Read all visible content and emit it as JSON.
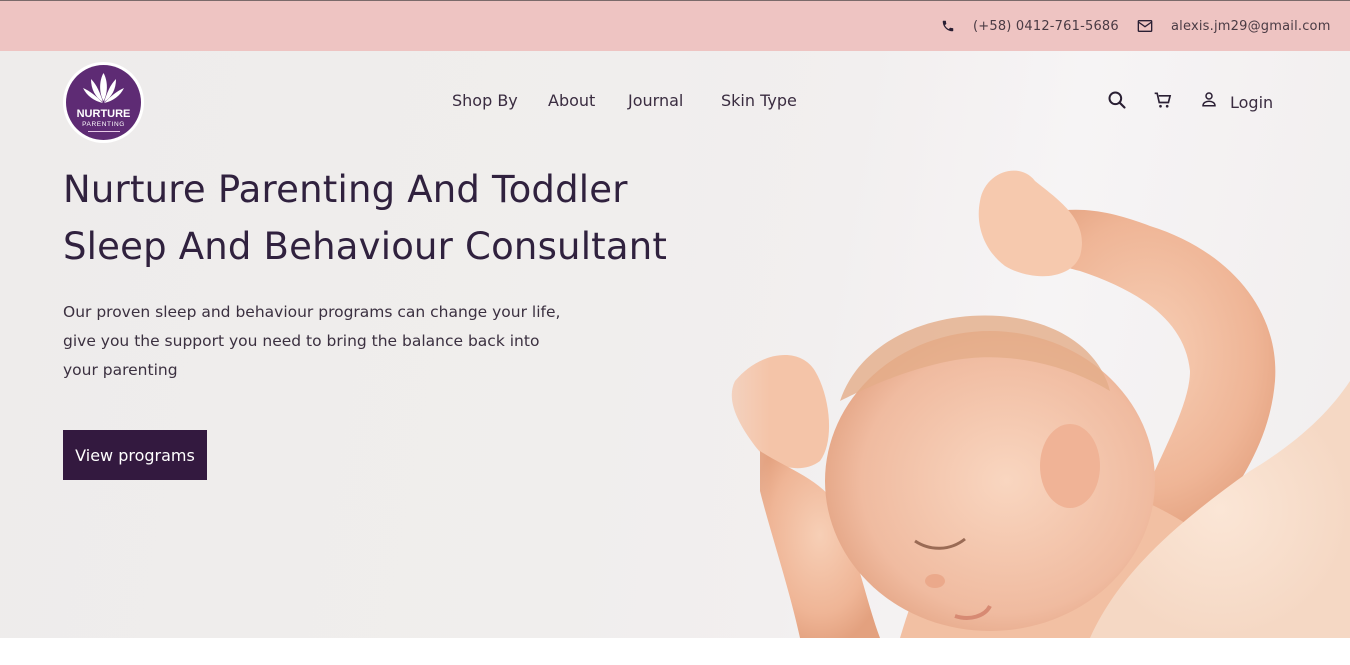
{
  "topbar": {
    "phone": "(+58) 0412-761-5686",
    "email": "alexis.jm29@gmail.com"
  },
  "logo": {
    "name": "NURTURE",
    "tagline": "PARENTING"
  },
  "nav": {
    "items": [
      "Shop By",
      "About",
      "Journal",
      "Skin Type"
    ]
  },
  "header_actions": {
    "search_icon": "search-icon",
    "cart_icon": "cart-icon",
    "user_icon": "user-icon",
    "login_label": "Login"
  },
  "hero": {
    "title_line1": "Nurture Parenting And Toddler",
    "title_line2": "Sleep And Behaviour Consultant",
    "description": "Our proven sleep and behaviour programs can change your life, give you the support you need to bring the balance back into your parenting",
    "cta_label": "View programs"
  },
  "colors": {
    "topbar_bg": "#eec4c2",
    "brand_purple": "#5e2b74",
    "cta_bg": "#33193f",
    "text_dark": "#30213e"
  }
}
